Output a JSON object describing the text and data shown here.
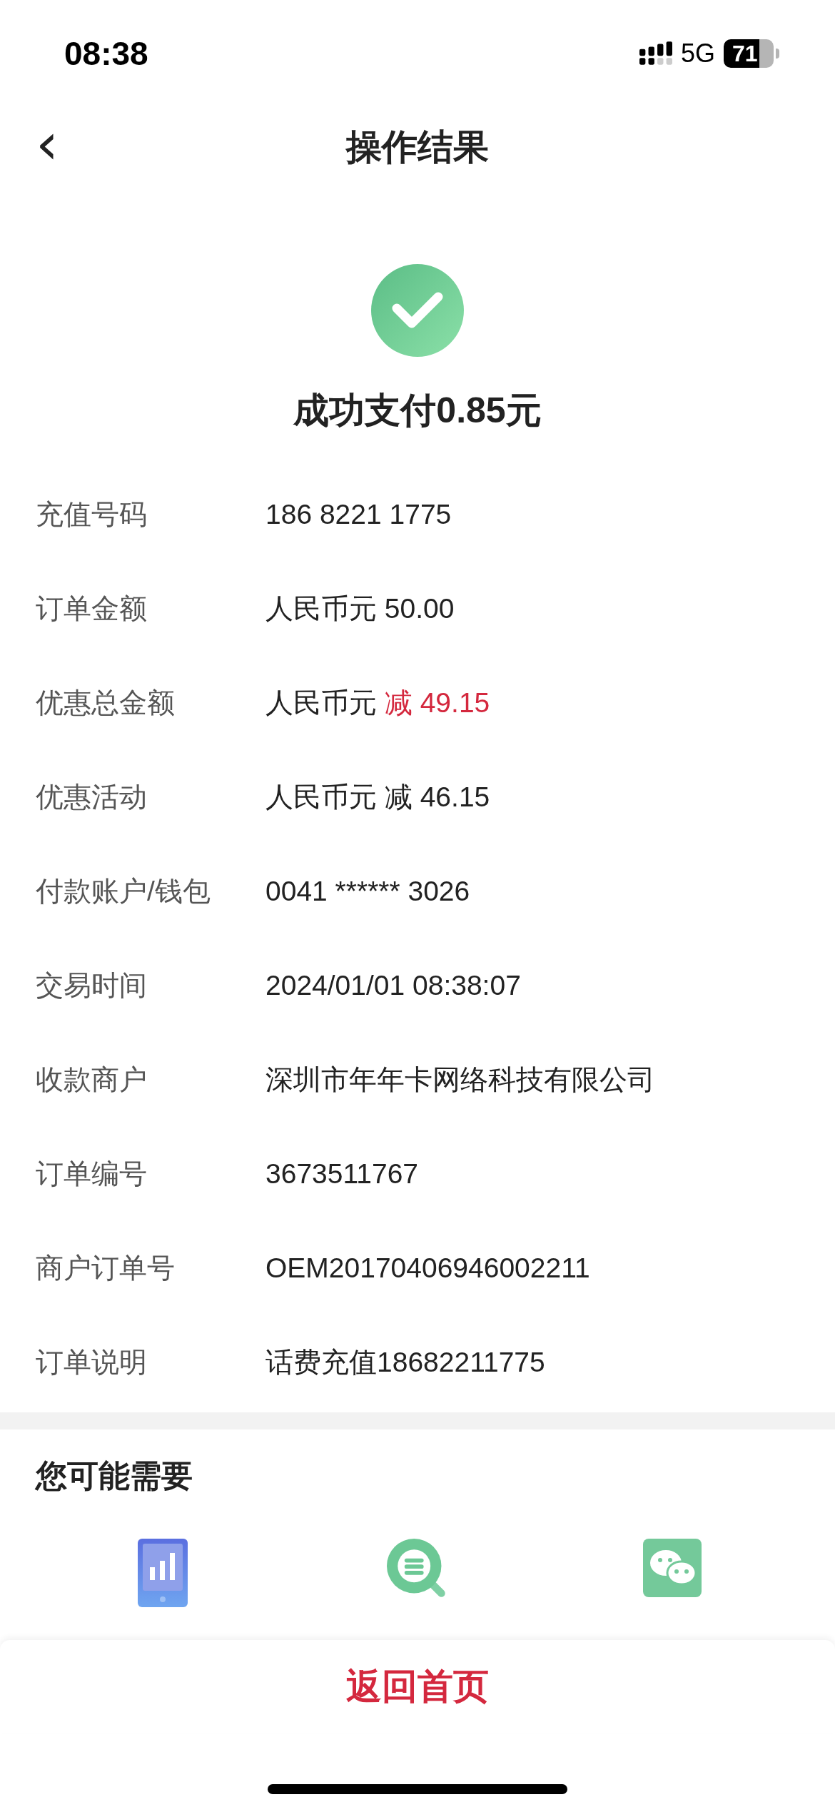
{
  "status_bar": {
    "time": "08:38",
    "network": "5G",
    "battery": "71"
  },
  "header": {
    "back": "‹",
    "title": "操作结果"
  },
  "result": {
    "title": "成功支付0.85元"
  },
  "details": [
    {
      "label": "充值号码",
      "value": "186 8221 1775"
    },
    {
      "label": "订单金额",
      "value": "人民币元 50.00"
    },
    {
      "label": "优惠总金额",
      "value": "人民币元",
      "emphasis": "减 49.15"
    },
    {
      "label": "优惠活动",
      "value": "人民币元 减 46.15"
    },
    {
      "label": "付款账户/钱包",
      "value": "0041 ****** 3026"
    },
    {
      "label": "交易时间",
      "value": "2024/01/01 08:38:07"
    },
    {
      "label": "收款商户",
      "value": "深圳市年年卡网络科技有限公司"
    },
    {
      "label": "订单编号",
      "value": "3673511767"
    },
    {
      "label": "商户订单号",
      "value": "OEM20170406946002211"
    },
    {
      "label": "订单说明",
      "value": "话费充值18682211775"
    }
  ],
  "suggestions": {
    "title": "您可能需要",
    "items": [
      {
        "kind": "data"
      },
      {
        "kind": "records"
      },
      {
        "kind": "share"
      }
    ]
  },
  "bottom_bar": {
    "button": "返回首页"
  }
}
